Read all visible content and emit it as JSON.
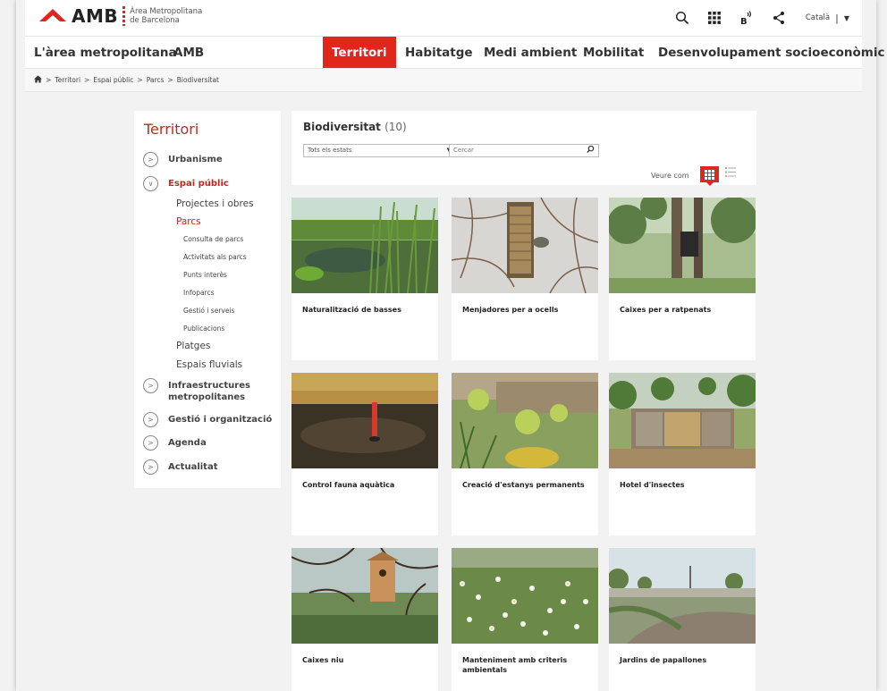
{
  "header": {
    "logo_text": "AMB",
    "logo_sub_line1": "Àrea Metropolitana",
    "logo_sub_line2": "de Barcelona",
    "language": "Català",
    "icons": [
      "search-icon",
      "apps-grid-icon",
      "accessibility-icon",
      "share-icon"
    ],
    "accent_color": "#e1261c"
  },
  "nav": {
    "items": [
      {
        "label": "L'àrea metropolitana"
      },
      {
        "label": "AMB"
      },
      {
        "label": "Territori",
        "active": true
      },
      {
        "label": "Habitatge"
      },
      {
        "label": "Medi ambient"
      },
      {
        "label": "Mobilitat"
      },
      {
        "label": "Desenvolupament socioeconòmic"
      }
    ]
  },
  "breadcrumb": {
    "items": [
      "Territori",
      "Espai públic",
      "Parcs",
      "Biodiversitat"
    ],
    "separator": ">"
  },
  "sidebar": {
    "title": "Territori",
    "items": [
      {
        "label": "Urbanisme"
      },
      {
        "label": "Espai públic",
        "active": true
      },
      {
        "label": "Projectes i obres"
      },
      {
        "label": "Parcs",
        "active": true
      },
      {
        "label": "Consulta de parcs"
      },
      {
        "label": "Activitats als parcs"
      },
      {
        "label": "Punts interès"
      },
      {
        "label": "Infoparcs"
      },
      {
        "label": "Gestió i serveis"
      },
      {
        "label": "Publicacions"
      },
      {
        "label": "Platges"
      },
      {
        "label": "Espais fluvials"
      },
      {
        "label": "Infraestructures metropolitanes"
      },
      {
        "label": "Gestió i organització"
      },
      {
        "label": "Agenda"
      },
      {
        "label": "Actualitat"
      }
    ]
  },
  "content": {
    "title": "Biodiversitat",
    "count": "(10)",
    "status_select": "Tots els estats",
    "search_placeholder": "Cercar",
    "view_label": "Veure com",
    "cards": [
      {
        "title": "Naturalització de basses"
      },
      {
        "title": "Menjadores per a ocells"
      },
      {
        "title": "Caixes per a ratpenats"
      },
      {
        "title": "Control fauna aquàtica"
      },
      {
        "title": "Creació d'estanys permanents"
      },
      {
        "title": "Hotel d'insectes"
      },
      {
        "title": "Caixes niu"
      },
      {
        "title": "Manteniment amb criteris ambientals"
      },
      {
        "title": "Jardins de papallones"
      }
    ]
  }
}
